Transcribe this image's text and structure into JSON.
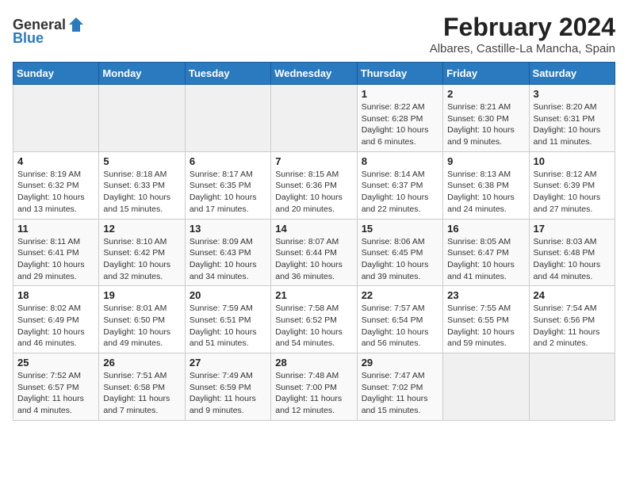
{
  "logo": {
    "general": "General",
    "blue": "Blue"
  },
  "header": {
    "title": "February 2024",
    "subtitle": "Albares, Castille-La Mancha, Spain"
  },
  "columns": [
    "Sunday",
    "Monday",
    "Tuesday",
    "Wednesday",
    "Thursday",
    "Friday",
    "Saturday"
  ],
  "weeks": [
    [
      {
        "day": "",
        "info": ""
      },
      {
        "day": "",
        "info": ""
      },
      {
        "day": "",
        "info": ""
      },
      {
        "day": "",
        "info": ""
      },
      {
        "day": "1",
        "info": "Sunrise: 8:22 AM\nSunset: 6:28 PM\nDaylight: 10 hours\nand 6 minutes."
      },
      {
        "day": "2",
        "info": "Sunrise: 8:21 AM\nSunset: 6:30 PM\nDaylight: 10 hours\nand 9 minutes."
      },
      {
        "day": "3",
        "info": "Sunrise: 8:20 AM\nSunset: 6:31 PM\nDaylight: 10 hours\nand 11 minutes."
      }
    ],
    [
      {
        "day": "4",
        "info": "Sunrise: 8:19 AM\nSunset: 6:32 PM\nDaylight: 10 hours\nand 13 minutes."
      },
      {
        "day": "5",
        "info": "Sunrise: 8:18 AM\nSunset: 6:33 PM\nDaylight: 10 hours\nand 15 minutes."
      },
      {
        "day": "6",
        "info": "Sunrise: 8:17 AM\nSunset: 6:35 PM\nDaylight: 10 hours\nand 17 minutes."
      },
      {
        "day": "7",
        "info": "Sunrise: 8:15 AM\nSunset: 6:36 PM\nDaylight: 10 hours\nand 20 minutes."
      },
      {
        "day": "8",
        "info": "Sunrise: 8:14 AM\nSunset: 6:37 PM\nDaylight: 10 hours\nand 22 minutes."
      },
      {
        "day": "9",
        "info": "Sunrise: 8:13 AM\nSunset: 6:38 PM\nDaylight: 10 hours\nand 24 minutes."
      },
      {
        "day": "10",
        "info": "Sunrise: 8:12 AM\nSunset: 6:39 PM\nDaylight: 10 hours\nand 27 minutes."
      }
    ],
    [
      {
        "day": "11",
        "info": "Sunrise: 8:11 AM\nSunset: 6:41 PM\nDaylight: 10 hours\nand 29 minutes."
      },
      {
        "day": "12",
        "info": "Sunrise: 8:10 AM\nSunset: 6:42 PM\nDaylight: 10 hours\nand 32 minutes."
      },
      {
        "day": "13",
        "info": "Sunrise: 8:09 AM\nSunset: 6:43 PM\nDaylight: 10 hours\nand 34 minutes."
      },
      {
        "day": "14",
        "info": "Sunrise: 8:07 AM\nSunset: 6:44 PM\nDaylight: 10 hours\nand 36 minutes."
      },
      {
        "day": "15",
        "info": "Sunrise: 8:06 AM\nSunset: 6:45 PM\nDaylight: 10 hours\nand 39 minutes."
      },
      {
        "day": "16",
        "info": "Sunrise: 8:05 AM\nSunset: 6:47 PM\nDaylight: 10 hours\nand 41 minutes."
      },
      {
        "day": "17",
        "info": "Sunrise: 8:03 AM\nSunset: 6:48 PM\nDaylight: 10 hours\nand 44 minutes."
      }
    ],
    [
      {
        "day": "18",
        "info": "Sunrise: 8:02 AM\nSunset: 6:49 PM\nDaylight: 10 hours\nand 46 minutes."
      },
      {
        "day": "19",
        "info": "Sunrise: 8:01 AM\nSunset: 6:50 PM\nDaylight: 10 hours\nand 49 minutes."
      },
      {
        "day": "20",
        "info": "Sunrise: 7:59 AM\nSunset: 6:51 PM\nDaylight: 10 hours\nand 51 minutes."
      },
      {
        "day": "21",
        "info": "Sunrise: 7:58 AM\nSunset: 6:52 PM\nDaylight: 10 hours\nand 54 minutes."
      },
      {
        "day": "22",
        "info": "Sunrise: 7:57 AM\nSunset: 6:54 PM\nDaylight: 10 hours\nand 56 minutes."
      },
      {
        "day": "23",
        "info": "Sunrise: 7:55 AM\nSunset: 6:55 PM\nDaylight: 10 hours\nand 59 minutes."
      },
      {
        "day": "24",
        "info": "Sunrise: 7:54 AM\nSunset: 6:56 PM\nDaylight: 11 hours\nand 2 minutes."
      }
    ],
    [
      {
        "day": "25",
        "info": "Sunrise: 7:52 AM\nSunset: 6:57 PM\nDaylight: 11 hours\nand 4 minutes."
      },
      {
        "day": "26",
        "info": "Sunrise: 7:51 AM\nSunset: 6:58 PM\nDaylight: 11 hours\nand 7 minutes."
      },
      {
        "day": "27",
        "info": "Sunrise: 7:49 AM\nSunset: 6:59 PM\nDaylight: 11 hours\nand 9 minutes."
      },
      {
        "day": "28",
        "info": "Sunrise: 7:48 AM\nSunset: 7:00 PM\nDaylight: 11 hours\nand 12 minutes."
      },
      {
        "day": "29",
        "info": "Sunrise: 7:47 AM\nSunset: 7:02 PM\nDaylight: 11 hours\nand 15 minutes."
      },
      {
        "day": "",
        "info": ""
      },
      {
        "day": "",
        "info": ""
      }
    ]
  ]
}
